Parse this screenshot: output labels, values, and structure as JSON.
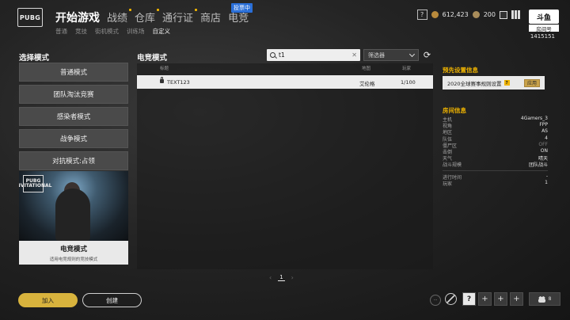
{
  "logo": {
    "text": "PUBG"
  },
  "main_nav": [
    {
      "label": "开始游戏",
      "active": true,
      "dot": false
    },
    {
      "label": "战绩",
      "active": false,
      "dot": true
    },
    {
      "label": "仓库",
      "active": false,
      "dot": true
    },
    {
      "label": "通行证",
      "active": false,
      "dot": true
    },
    {
      "label": "商店",
      "active": false,
      "dot": false
    },
    {
      "label": "电竞",
      "active": false,
      "dot": false
    }
  ],
  "vote_badge": "投票中",
  "sub_nav": [
    {
      "label": "普通",
      "active": false
    },
    {
      "label": "竞技",
      "active": false
    },
    {
      "label": "街机模式",
      "active": false
    },
    {
      "label": "训练场",
      "active": false
    },
    {
      "label": "自定义",
      "active": true
    }
  ],
  "currency": {
    "bp": "612,423",
    "g_coin": "200"
  },
  "room": {
    "logo_text": "斗鱼",
    "label": "房间号",
    "number": "1415151"
  },
  "left": {
    "title": "选择模式",
    "modes": [
      "普通模式",
      "团队淘汰竞赛",
      "感染者模式",
      "战争模式",
      "对抗模式:占领"
    ],
    "promo": {
      "badge": "PUBG INVITATIONAL",
      "name": "电竞模式",
      "desc": "适用电竞规则的竞技模式"
    }
  },
  "center": {
    "title": "电竞模式",
    "search": {
      "value": "t1",
      "placeholder": ""
    },
    "filter_label": "筛选器",
    "columns": {
      "title": "标题",
      "map": "地图",
      "players": "玩家"
    },
    "rows": [
      {
        "title": "TEXT123",
        "map": "艾伦格",
        "players": "1/100",
        "locked": true
      }
    ],
    "pager": {
      "current": "1",
      "prev": "‹",
      "next": "›"
    }
  },
  "right": {
    "preset_title": "预先设置信息",
    "preset_value": "2020全球赛事规则设置",
    "apply_label": "应用",
    "info_title": "房间信息",
    "info": [
      {
        "key": "主机",
        "value": "4Gamers_3"
      },
      {
        "key": "视角",
        "value": "FPP"
      },
      {
        "key": "地区",
        "value": "AS"
      },
      {
        "key": "队伍",
        "value": "4"
      },
      {
        "key": "僵尸区",
        "value": "OFF",
        "dim": true
      },
      {
        "key": "击倒",
        "value": "ON"
      },
      {
        "key": "天气",
        "value": "晴天"
      },
      {
        "key": "战斗规模",
        "value": "团队战斗"
      }
    ],
    "info2": [
      {
        "key": "进行时间",
        "value": "-"
      },
      {
        "key": "玩家",
        "value": "1"
      }
    ]
  },
  "bottom": {
    "join_label": "加入",
    "create_label": "创建",
    "chat_label": "···",
    "squad_slots": [
      "?",
      "+",
      "+",
      "+"
    ],
    "friends_count": "8"
  },
  "colors": {
    "accent": "#d8b33d",
    "badge_blue": "#2a6fd8"
  },
  "icons": [
    "search-icon",
    "clear-icon",
    "refresh-icon",
    "lock-icon",
    "chevron-down-icon",
    "help-icon",
    "coin-icon",
    "chat-icon",
    "mic-muted-icon",
    "people-icon"
  ]
}
